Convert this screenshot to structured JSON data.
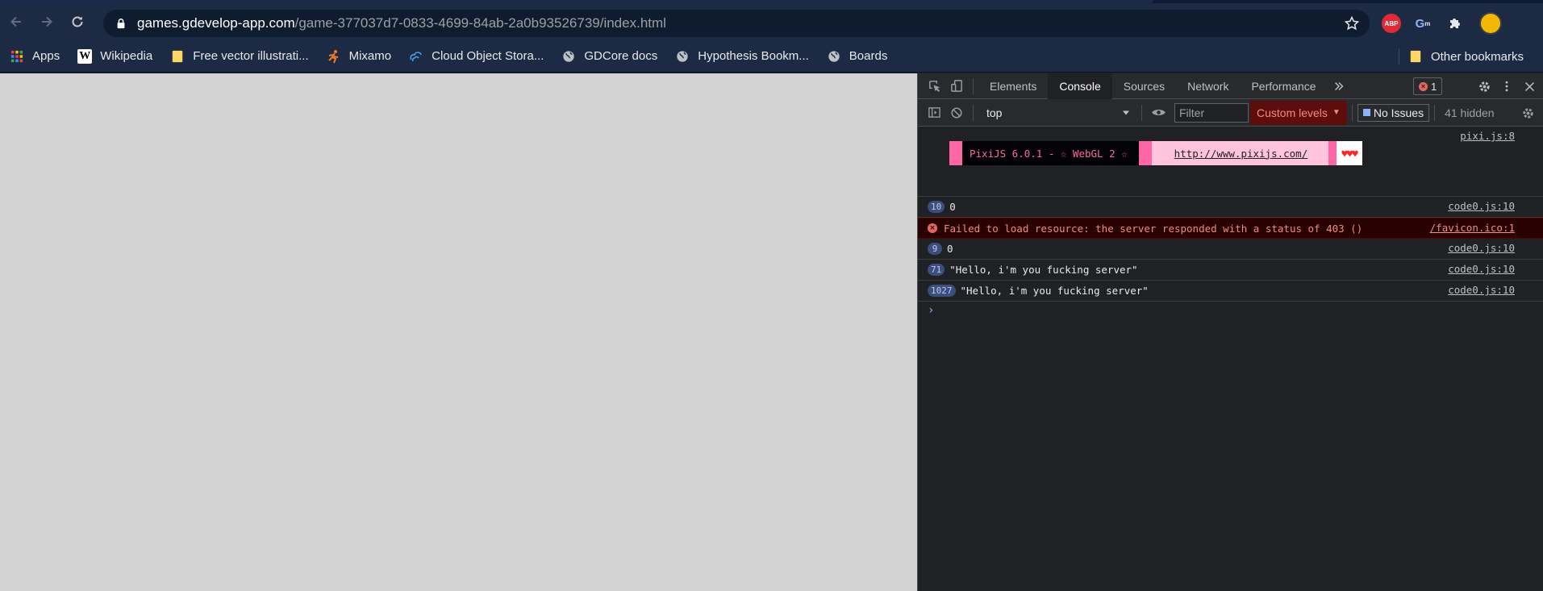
{
  "browser": {
    "url_host": "games.gdevelop-app.com",
    "url_path": "/game-377037d7-0833-4699-84ab-2a0b93526739/index.html",
    "extensions": {
      "abp_label": "ABP",
      "gm_label": "G",
      "gm_small": "m"
    }
  },
  "bookmarks": {
    "items": [
      {
        "label": "Apps",
        "icon": "apps-grid-icon"
      },
      {
        "label": "Wikipedia",
        "icon": "wikipedia-icon"
      },
      {
        "label": "Free vector illustrati...",
        "icon": "folder-icon"
      },
      {
        "label": "Mixamo",
        "icon": "mixamo-icon"
      },
      {
        "label": "Cloud Object Stora...",
        "icon": "cloud-icon"
      },
      {
        "label": "GDCore docs",
        "icon": "globe-icon"
      },
      {
        "label": "Hypothesis Bookm...",
        "icon": "globe-icon"
      },
      {
        "label": "Boards",
        "icon": "globe-icon"
      }
    ],
    "other": "Other bookmarks"
  },
  "devtools": {
    "tabs": [
      "Elements",
      "Console",
      "Sources",
      "Network",
      "Performance"
    ],
    "active_tab": "Console",
    "error_count": "1",
    "context": "top",
    "filter_placeholder": "Filter",
    "levels": "Custom levels",
    "issues": "No Issues",
    "hidden": "41 hidden"
  },
  "console": {
    "pixi": {
      "source": "pixi.js:8",
      "text": "PixiJS 6.0.1 - ☆ WebGL 2 ☆",
      "link": "http://www.pixijs.com/",
      "hearts": "♥♥♥"
    },
    "messages": [
      {
        "count": "10",
        "text": "0",
        "source": "code0.js:10",
        "type": "log"
      },
      {
        "count": "",
        "text": "Failed to load resource: the server responded with a status of 403 ()",
        "source": "/favicon.ico:1",
        "type": "error"
      },
      {
        "count": "9",
        "text": "0",
        "source": "code0.js:10",
        "type": "log"
      },
      {
        "count": "71",
        "text": "\"Hello, i'm you fucking server\"",
        "source": "code0.js:10",
        "type": "log"
      },
      {
        "count": "1027",
        "text": "\"Hello, i'm you fucking server\"",
        "source": "code0.js:10",
        "type": "log"
      }
    ],
    "prompt": "›"
  },
  "colors": {
    "chrome_bg": "#1c2a44",
    "page_bg": "#d3d3d3",
    "devtools_bg": "#202124",
    "error_bg": "#290000",
    "error_text": "#f28b82",
    "pixi_pink": "#ff66a5"
  }
}
